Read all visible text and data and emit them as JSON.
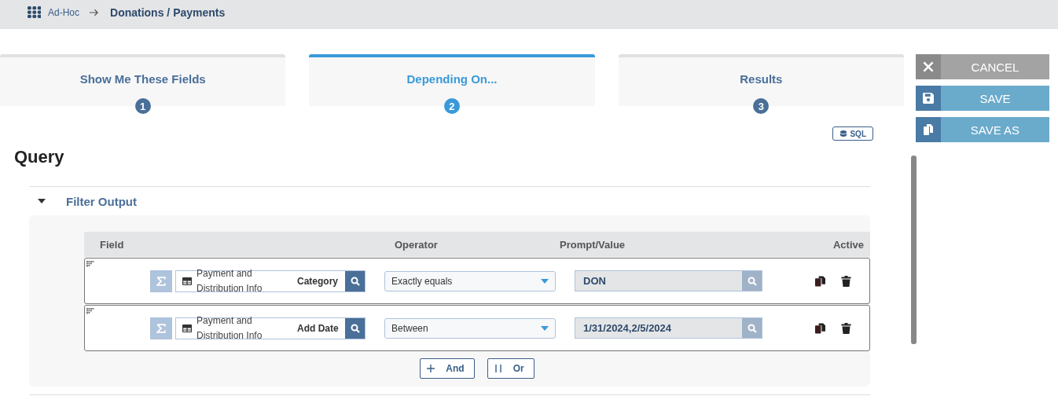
{
  "breadcrumb": {
    "parent": "Ad-Hoc",
    "current": "Donations / Payments"
  },
  "steps": [
    {
      "label": "Show Me These Fields",
      "number": "1",
      "selected": false
    },
    {
      "label": "Depending On...",
      "number": "2",
      "selected": true
    },
    {
      "label": "Results",
      "number": "3",
      "selected": false
    }
  ],
  "actions": [
    {
      "kind": "cancel",
      "label": "CANCEL"
    },
    {
      "kind": "save",
      "label": "SAVE"
    },
    {
      "kind": "save_as",
      "label": "SAVE AS"
    }
  ],
  "sql_button": {
    "label": "SQL"
  },
  "heading": "Query",
  "section": {
    "title": "Filter Output",
    "expanded": true
  },
  "table": {
    "columns": [
      "Field",
      "Operator",
      "Prompt/Value",
      "Active"
    ],
    "rows": [
      {
        "table_name": "Payment and Distribution Info",
        "field": "Category",
        "operator": "Exactly equals",
        "value": "DON"
      },
      {
        "table_name": "Payment and Distribution Info",
        "field": "Add Date",
        "operator": "Between",
        "value": "1/31/2024,2/5/2024"
      }
    ]
  },
  "logic_buttons": [
    {
      "kind": "and",
      "label": "And"
    },
    {
      "kind": "or",
      "label": "Or"
    }
  ]
}
